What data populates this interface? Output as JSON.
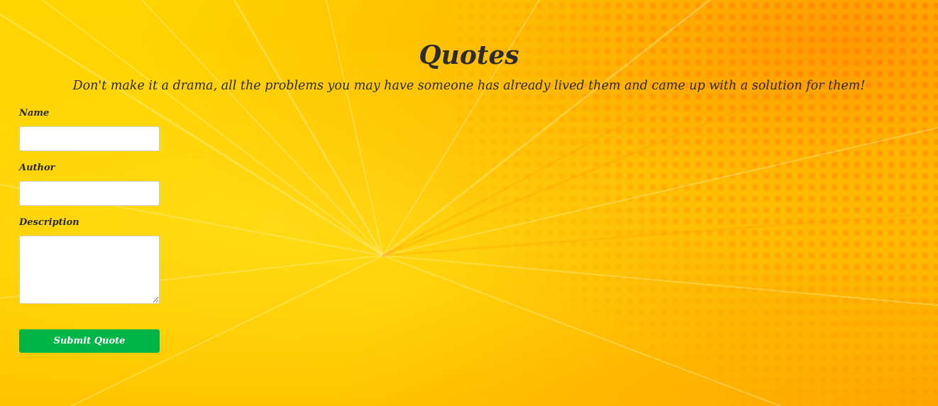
{
  "page": {
    "title": "Quotes",
    "subtitle": "Don't make it a drama, all the problems you may have someone has already lived them and came up with a solution for them!"
  },
  "form": {
    "name_label": "Name",
    "name_value": "",
    "author_label": "Author",
    "author_value": "",
    "description_label": "Description",
    "description_value": "",
    "submit_label": "Submit Quote"
  },
  "colors": {
    "background": "#ffd200",
    "accent_orange": "#ff8c00",
    "submit_button": "#00b547",
    "text": "#2b2b2b"
  }
}
